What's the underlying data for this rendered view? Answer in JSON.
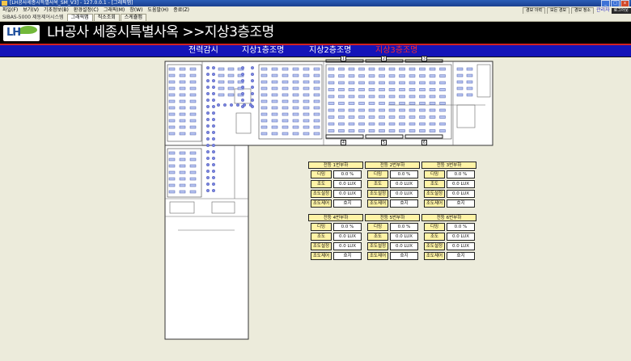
{
  "window": {
    "title": "[LH공사세종시특별사옥_SM_V3] - 127.0.0.1 - [그래픽맵]",
    "buttons": [
      "_",
      "□",
      "x"
    ]
  },
  "menubar": {
    "items": [
      "파일(F)",
      "보기(V)",
      "기초정보(B)",
      "환경설정(C)",
      "그래픽(M)",
      "창(W)",
      "도움말(H)",
      "종료(Z)"
    ],
    "right_buttons": [
      "경보 이력",
      "모든 경보",
      "경보 청소"
    ],
    "user": "관리자",
    "logout": "로그아웃"
  },
  "tabbar": {
    "system_label": "SIBAS-5000 제동제어시스템",
    "tabs": [
      {
        "label": "그래픽맵",
        "active": true
      },
      {
        "label": "직소조회",
        "active": false
      },
      {
        "label": "스케쥴맵",
        "active": false
      }
    ]
  },
  "header": {
    "logo_text": "LH",
    "title": "LH공사 세종시특별사옥 >>지상3층조명"
  },
  "nav": {
    "items": [
      {
        "label": "전력감시",
        "active": false
      },
      {
        "label": "지상1층조명",
        "active": false
      },
      {
        "label": "지상2층조명",
        "active": false
      },
      {
        "label": "지상3층조명",
        "active": true
      }
    ]
  },
  "zone_markers": [
    "1",
    "2",
    "3",
    "4",
    "5",
    "6"
  ],
  "panels": [
    {
      "title": "전등 1번부하",
      "rows": [
        {
          "label": "디밍",
          "value": "0.0 %"
        },
        {
          "label": "조도",
          "value": "0.0 LUX"
        },
        {
          "label": "조도설정",
          "value": "0.0 LUX"
        },
        {
          "label": "조도제어",
          "value": "호지"
        }
      ]
    },
    {
      "title": "전등 2번부하",
      "rows": [
        {
          "label": "디밍",
          "value": "0.0 %"
        },
        {
          "label": "조도",
          "value": "0.0 LUX"
        },
        {
          "label": "조도설정",
          "value": "0.0 LUX"
        },
        {
          "label": "조도제어",
          "value": "호지"
        }
      ]
    },
    {
      "title": "전등 3번부하",
      "rows": [
        {
          "label": "디밍",
          "value": "0.0 %"
        },
        {
          "label": "조도",
          "value": "0.0 LUX"
        },
        {
          "label": "조도설정",
          "value": "0.0 LUX"
        },
        {
          "label": "조도제어",
          "value": "호지"
        }
      ]
    },
    {
      "title": "전등 4번부하",
      "rows": [
        {
          "label": "디밍",
          "value": "0.0 %"
        },
        {
          "label": "조도",
          "value": "0.0 LUX"
        },
        {
          "label": "조도설정",
          "value": "0.0 LUX"
        },
        {
          "label": "조도제어",
          "value": "호지"
        }
      ]
    },
    {
      "title": "전등 5번부하",
      "rows": [
        {
          "label": "디밍",
          "value": "0.0 %"
        },
        {
          "label": "조도",
          "value": "0.0 LUX"
        },
        {
          "label": "조도설정",
          "value": "0.0 LUX"
        },
        {
          "label": "조도제어",
          "value": "호지"
        }
      ]
    },
    {
      "title": "전등 6번부하",
      "rows": [
        {
          "label": "디밍",
          "value": "0.0 %"
        },
        {
          "label": "조도",
          "value": "0.0 LUX"
        },
        {
          "label": "조도설정",
          "value": "0.0 LUX"
        },
        {
          "label": "조도제어",
          "value": "호지"
        }
      ]
    }
  ]
}
